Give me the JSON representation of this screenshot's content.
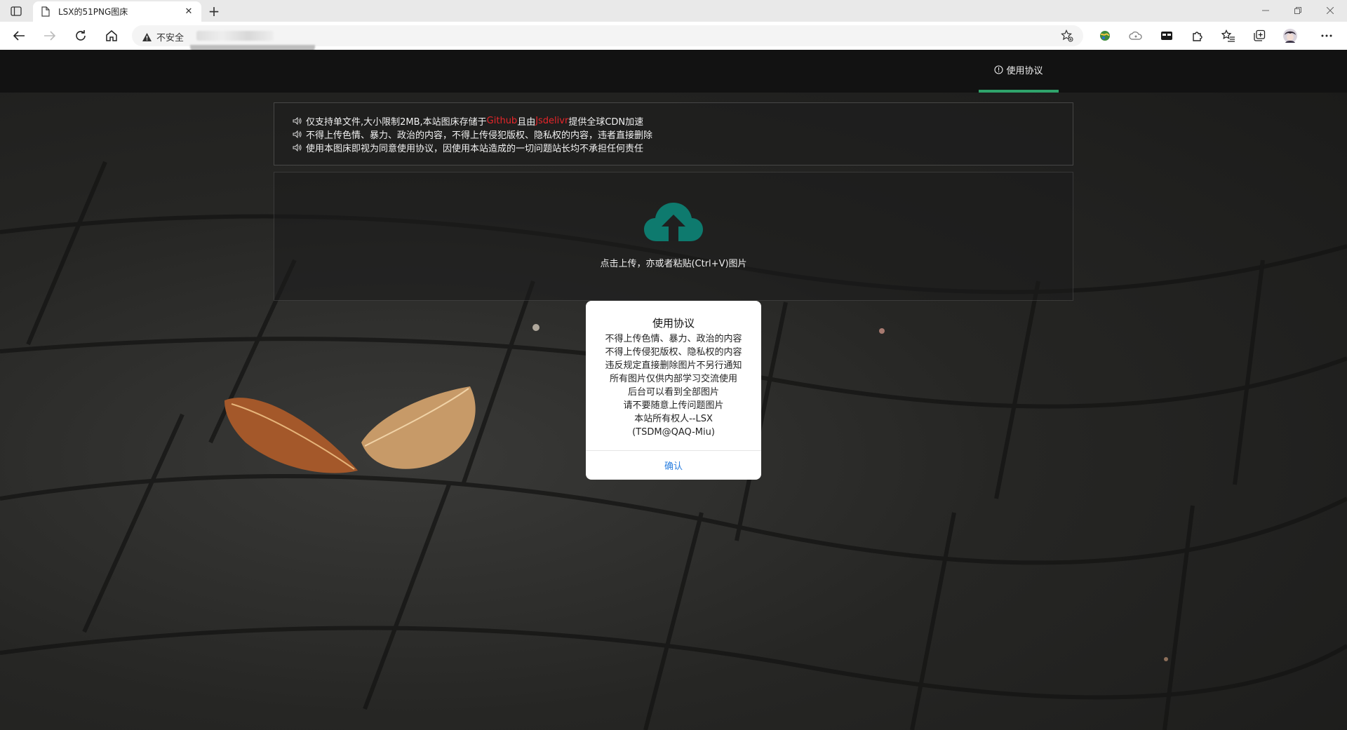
{
  "browser": {
    "tab_title": "LSX的51PNG图床",
    "tab_close": "✕",
    "new_tab": "+",
    "security_label": "不安全"
  },
  "navbar": {
    "agreement_label": "使用协议",
    "accent_color": "#2fa36b"
  },
  "notice": {
    "lines": [
      {
        "pre": "仅支持单文件,大小限制2MB,本站图床存储于",
        "red1": "Github",
        "mid": "且由",
        "red2": "Jsdelivr",
        "post": "提供全球CDN加速"
      },
      {
        "text": "不得上传色情、暴力、政治的内容，不得上传侵犯版权、隐私权的内容，违者直接删除"
      },
      {
        "text": "使用本图床即视为同意使用协议，因使用本站造成的一切问题站长均不承担任何责任"
      }
    ],
    "highlight_color": "#e8262a"
  },
  "upload": {
    "icon": "cloud-upload-icon",
    "icon_color": "#0e7a6e",
    "hint": "点击上传，亦或者粘贴(Ctrl+V)图片"
  },
  "modal": {
    "title": "使用协议",
    "lines": [
      "不得上传色情、暴力、政治的内容",
      "不得上传侵犯版权、隐私权的内容",
      "违反规定直接删除图片不另行通知",
      "所有图片仅供内部学习交流使用",
      "后台可以看到全部图片",
      "请不要随意上传问题图片",
      "本站所有权人--LSX",
      "(TSDM@QAQ-Miu)"
    ],
    "confirm_label": "确认",
    "confirm_color": "#2a7fe0"
  }
}
